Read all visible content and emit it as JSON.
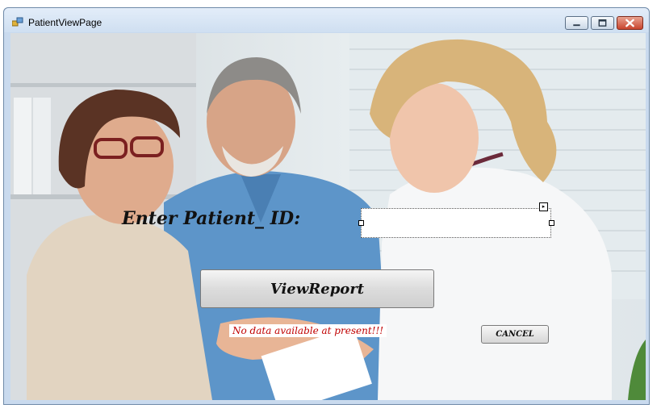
{
  "window": {
    "title": "PatientViewPage",
    "controls": {
      "minimize": "minimize-icon",
      "maximize": "maximize-icon",
      "close": "close-icon"
    }
  },
  "form": {
    "patient_id_label": "Enter Patient_ ID:",
    "patient_id_value": "",
    "view_report_label": "ViewReport",
    "status_message": "No data available at present!!!",
    "cancel_label": "CANCEL"
  },
  "colors": {
    "status_text": "#c00000",
    "title_bar": "#cfdff1",
    "close_button": "#c9452e"
  }
}
